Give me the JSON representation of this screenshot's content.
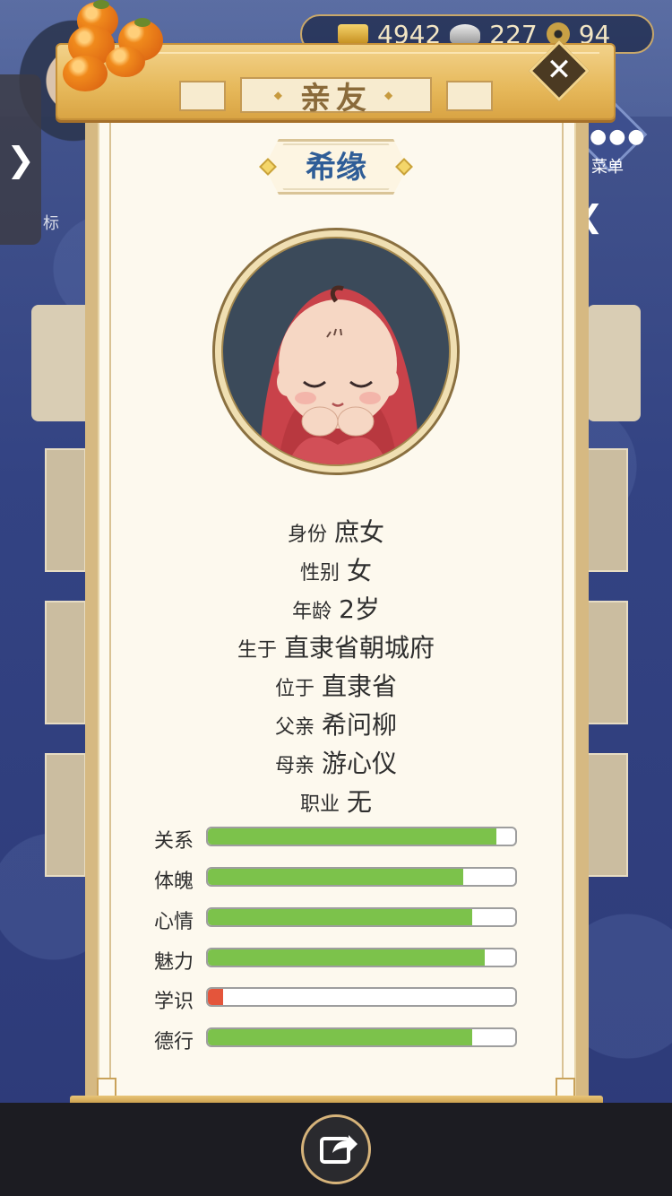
{
  "currency": {
    "gold": "4942",
    "silver": "227",
    "coin": "94"
  },
  "background": {
    "menu_label": "菜单",
    "side_label": "标"
  },
  "panel": {
    "title": "亲友",
    "name": "希缘"
  },
  "info": [
    {
      "key": "身份",
      "value": "庶女"
    },
    {
      "key": "性别",
      "value": "女"
    },
    {
      "key": "年龄",
      "value": "2岁"
    },
    {
      "key": "生于",
      "value": "直隶省朝城府"
    },
    {
      "key": "位于",
      "value": "直隶省"
    },
    {
      "key": "父亲",
      "value": "希问柳"
    },
    {
      "key": "母亲",
      "value": "游心仪"
    },
    {
      "key": "职业",
      "value": "无"
    }
  ],
  "stats": [
    {
      "label": "关系",
      "value": 0.94
    },
    {
      "label": "体魄",
      "value": 0.83
    },
    {
      "label": "心情",
      "value": 0.86
    },
    {
      "label": "魅力",
      "value": 0.9
    },
    {
      "label": "学识",
      "value": 0.05
    },
    {
      "label": "德行",
      "value": 0.86
    }
  ],
  "colors": {
    "bar_fill": "#7cc24b",
    "bar_low": "#e4553b",
    "name": "#2f5d97"
  }
}
